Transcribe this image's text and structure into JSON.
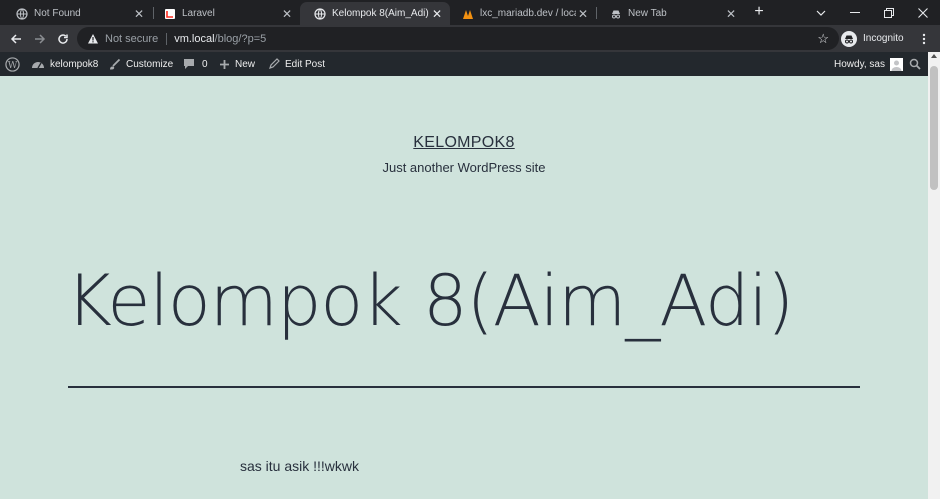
{
  "browser": {
    "tabs": [
      {
        "title": "Not Found",
        "favicon": "globe-icon",
        "active": false
      },
      {
        "title": "Laravel",
        "favicon": "laravel-icon",
        "active": false
      },
      {
        "title": "Kelompok 8(Aim_Adi) – ke",
        "favicon": "globe-icon",
        "active": true
      },
      {
        "title": "lxc_mariadb.dev / localho",
        "favicon": "phpmyadmin-icon",
        "active": false
      },
      {
        "title": "New Tab",
        "favicon": "incognito-icon",
        "active": false
      }
    ],
    "close_glyph": "✕",
    "new_tab_glyph": "+",
    "address": {
      "security_label": "Not secure",
      "host": "vm.local",
      "path": "/blog/?p=5"
    },
    "profile_label": "Incognito"
  },
  "admin_bar": {
    "site_name": "kelompok8",
    "customize": "Customize",
    "comments_count": "0",
    "new": "New",
    "edit_post": "Edit Post",
    "howdy": "Howdy, sas"
  },
  "page": {
    "site_title": "KELOMPOK8",
    "site_description": "Just another WordPress site",
    "post_title": "Kelompok 8(Aim_Adi)",
    "post_content": "sas itu asik !!!wkwk"
  },
  "colors": {
    "page_background": "#cfe3dc",
    "text": "#28303d",
    "admin_bar": "#23282d",
    "chrome_dark": "#202124",
    "chrome_toolbar": "#35363a"
  }
}
